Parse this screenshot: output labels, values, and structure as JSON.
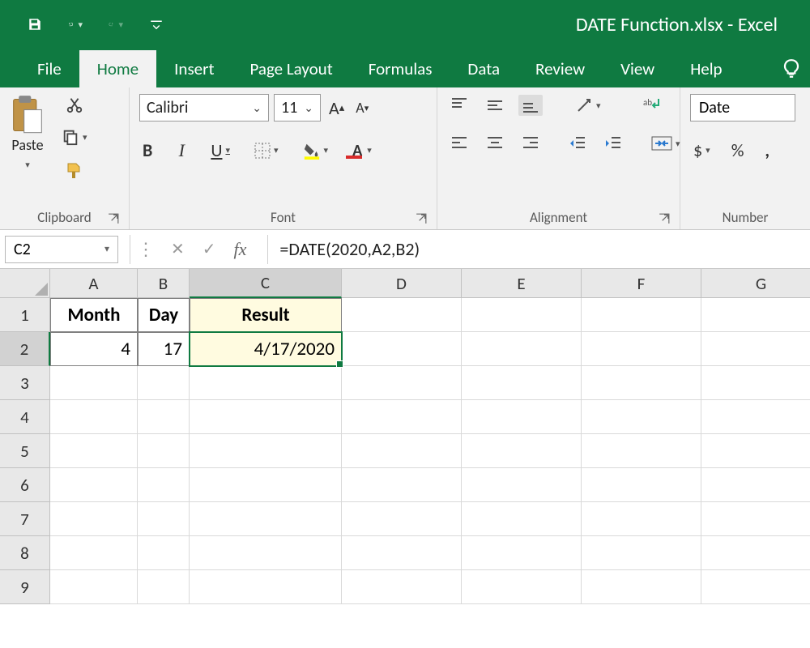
{
  "titlebar": {
    "filename": "DATE Function.xlsx",
    "appname": "Excel",
    "sep": " - "
  },
  "tabs": [
    "File",
    "Home",
    "Insert",
    "Page Layout",
    "Formulas",
    "Data",
    "Review",
    "View",
    "Help"
  ],
  "active_tab": "Home",
  "ribbon": {
    "clipboard": {
      "label": "Clipboard",
      "paste": "Paste"
    },
    "font": {
      "label": "Font",
      "name": "Calibri",
      "size": "11",
      "bold": "B",
      "italic": "I",
      "underline": "U"
    },
    "alignment": {
      "label": "Alignment"
    },
    "number": {
      "label": "Number",
      "format": "Date",
      "currency": "$",
      "percent": "%",
      "comma": ","
    }
  },
  "fxbar": {
    "namebox": "C2",
    "fx": "fx",
    "formula": "=DATE(2020,A2,B2)"
  },
  "grid": {
    "cols": [
      "A",
      "B",
      "C",
      "D",
      "E",
      "F",
      "G"
    ],
    "rows": [
      "1",
      "2",
      "3",
      "4",
      "5",
      "6",
      "7",
      "8",
      "9"
    ],
    "headers": {
      "A": "Month",
      "B": "Day",
      "C": "Result"
    },
    "data": {
      "A2": "4",
      "B2": "17",
      "C2": "4/17/2020"
    },
    "active": "C2"
  }
}
